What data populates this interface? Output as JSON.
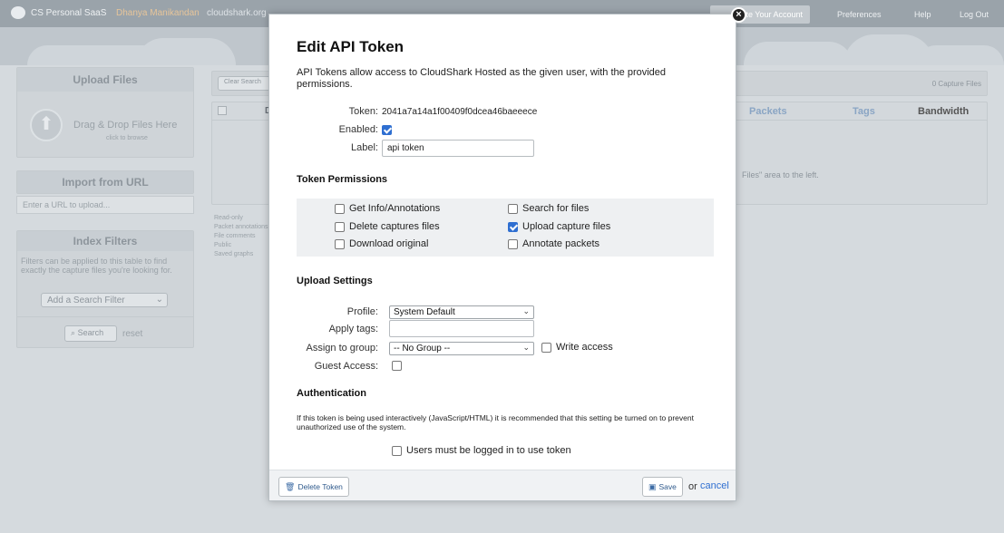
{
  "topbar": {
    "brand": "CS Personal SaaS",
    "user": "Dhanya Manikandan",
    "domain": "cloudshark.org",
    "account_button": "te Your Account",
    "preferences": "Preferences",
    "help": "Help",
    "logout": "Log Out"
  },
  "sidebar": {
    "upload_title": "Upload Files",
    "drop_text": "Drag & Drop Files Here",
    "drop_sub": "click to browse",
    "import_title": "Import from URL",
    "import_placeholder": "Enter a URL to upload...",
    "filters_title": "Index Filters",
    "filters_desc": "Filters can be applied to this table to find exactly the capture files you're looking for.",
    "filter_select": "Add a Search Filter",
    "search_button": "Search",
    "reset_link": "reset"
  },
  "legend": [
    "Read-only",
    "Packet annotations",
    "File comments",
    "Public",
    "Saved graphs"
  ],
  "files_table": {
    "toolbar_left": "Clear Search",
    "capture_count": "0 Capture Files",
    "col_d": "D",
    "columns": [
      "Packets",
      "Tags",
      "Bandwidth"
    ],
    "empty_text": "Files\" area to the left."
  },
  "modal": {
    "title": "Edit API Token",
    "description": "API Tokens allow access to CloudShark Hosted as the given user, with the provided permissions.",
    "token_label": "Token:",
    "token_value": "2041a7a14a1f00409f0dcea46baeeece",
    "enabled_label": "Enabled:",
    "enabled": true,
    "label_label": "Label:",
    "label_value": "api token",
    "permissions_heading": "Token Permissions",
    "permissions": [
      {
        "label": "Get Info/Annotations",
        "checked": false
      },
      {
        "label": "Search for files",
        "checked": false
      },
      {
        "label": "Delete captures files",
        "checked": false
      },
      {
        "label": "Upload capture files",
        "checked": true
      },
      {
        "label": "Download original",
        "checked": false
      },
      {
        "label": "Annotate packets",
        "checked": false
      }
    ],
    "upload_heading": "Upload Settings",
    "profile_label": "Profile:",
    "profile_value": "System Default",
    "apply_tags_label": "Apply tags:",
    "apply_tags_value": "",
    "assign_group_label": "Assign to group:",
    "assign_group_value": "-- No Group --",
    "write_access_label": "Write access",
    "guest_access_label": "Guest Access:",
    "auth_heading": "Authentication",
    "auth_text": "If this token is being used interactively (JavaScript/HTML) it is recommended that this setting be turned on to prevent unauthorized use of the system.",
    "logged_in_label": "Users must be logged in to use token",
    "delete_button": "Delete Token",
    "save_button": "Save",
    "or_text": "or",
    "cancel_link": "cancel"
  }
}
